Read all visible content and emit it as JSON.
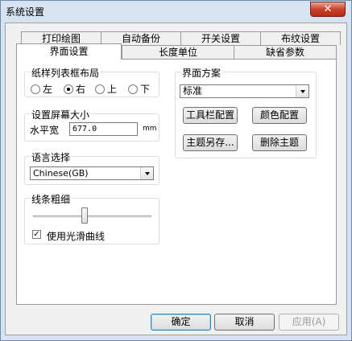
{
  "window": {
    "title": "系统设置",
    "close_symbol": "✕"
  },
  "tabs_top": [
    "打印绘图",
    "自动备份",
    "开关设置",
    "布纹设置"
  ],
  "tabs_bottom": [
    "界面设置",
    "长度单位",
    "缺省参数"
  ],
  "active_tab": "界面设置",
  "layout_group": {
    "title": "纸样列表框布局",
    "options": [
      "左",
      "右",
      "上",
      "下"
    ],
    "selected": "右"
  },
  "screen_group": {
    "title": "设置屏幕大小",
    "width_label": "水平宽",
    "width_value": "677.0",
    "unit": "mm"
  },
  "language_group": {
    "title": "语言选择",
    "selected": "Chinese(GB)"
  },
  "line_group": {
    "title": "线条粗细",
    "smooth_label": "使用光滑曲线",
    "smooth_checked": true,
    "check_symbol": "✓"
  },
  "scheme_group": {
    "title": "界面方案",
    "selected": "标准",
    "buttons": [
      "工具栏配置",
      "颜色配置",
      "主题另存...",
      "删除主题"
    ]
  },
  "footer": {
    "ok": "确定",
    "cancel": "取消",
    "apply": "应用(A)"
  }
}
